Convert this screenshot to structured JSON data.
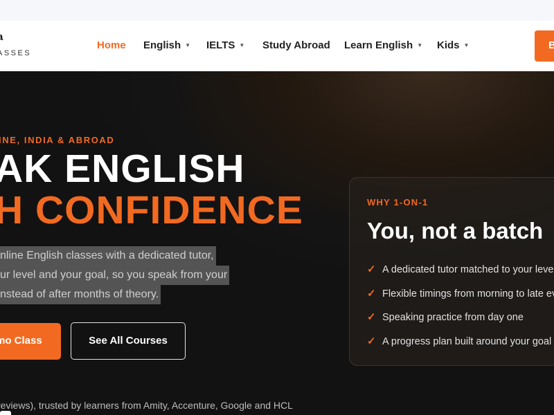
{
  "brand": {
    "name": "a",
    "tagline": "ASSES"
  },
  "nav": {
    "items": [
      {
        "label": "Home",
        "active": true
      },
      {
        "label": "English",
        "dropdown": true
      },
      {
        "label": "IELTS",
        "dropdown": true
      },
      {
        "label": "Study Abroad"
      },
      {
        "label": "Learn English",
        "dropdown": true
      },
      {
        "label": "Kids",
        "dropdown": true
      }
    ],
    "cta_label": "B"
  },
  "hero": {
    "eyebrow": "INE, INDIA & ABROAD",
    "title_line1": "AK ENGLISH",
    "title_line2": "H CONFIDENCE",
    "description_lines": [
      "nline English classes with a dedicated tutor,",
      "ur level and your goal, so you speak from your",
      "nstead of after months of theory."
    ],
    "primary_button": "mo Class",
    "secondary_button": "See All Courses",
    "reviews_text": "reviews), trusted by learners from Amity, Accenture, Google and HCL"
  },
  "card": {
    "eyebrow": "WHY 1-ON-1",
    "title": "You, not a batch",
    "points": [
      "A dedicated tutor matched to your level",
      "Flexible timings from morning to late eve",
      "Speaking practice from day one",
      "A progress plan built around your goal"
    ]
  },
  "colors": {
    "accent": "#f26a21",
    "hero_bg": "#141414",
    "nav_bg": "#ffffff"
  },
  "icons": {
    "caret": "chevron-down-icon",
    "check": "check-icon"
  }
}
